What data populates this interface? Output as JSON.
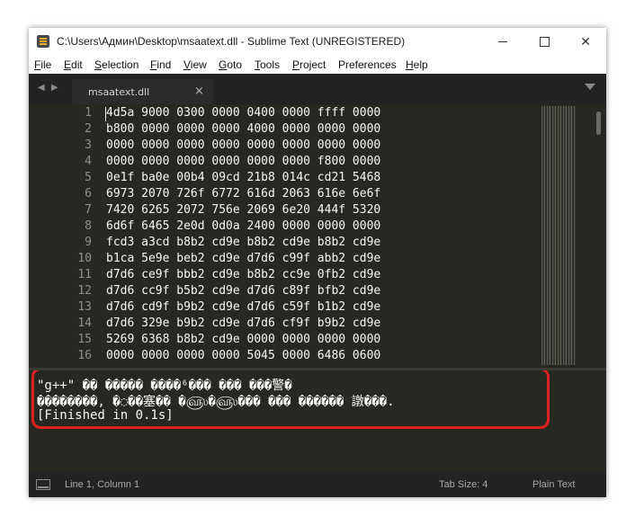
{
  "window": {
    "title": "C:\\Users\\Админ\\Desktop\\msaatext.dll - Sublime Text (UNREGISTERED)",
    "controls": {
      "minimize": "minimize",
      "maximize": "maximize",
      "close": "✕"
    }
  },
  "menu": [
    {
      "accel": "F",
      "rest": "ile"
    },
    {
      "accel": "E",
      "rest": "dit"
    },
    {
      "accel": "S",
      "rest": "election"
    },
    {
      "accel": "F",
      "rest": "ind"
    },
    {
      "accel": "V",
      "rest": "iew"
    },
    {
      "accel": "G",
      "rest": "oto"
    },
    {
      "accel": "T",
      "rest": "ools"
    },
    {
      "accel": "P",
      "rest": "roject"
    },
    {
      "accel": "",
      "rest": "Preferences"
    },
    {
      "accel": "H",
      "rest": "elp"
    }
  ],
  "tabs": {
    "nav": "◀ ▶",
    "active": {
      "label": "msaatext.dll",
      "close": "×"
    }
  },
  "editor": {
    "line_numbers": [
      "1",
      "2",
      "3",
      "4",
      "5",
      "6",
      "7",
      "8",
      "9",
      "10",
      "11",
      "12",
      "13",
      "14",
      "15",
      "16"
    ],
    "lines": [
      "4d5a 9000 0300 0000 0400 0000 ffff 0000",
      "b800 0000 0000 0000 4000 0000 0000 0000",
      "0000 0000 0000 0000 0000 0000 0000 0000",
      "0000 0000 0000 0000 0000 0000 f800 0000",
      "0e1f ba0e 00b4 09cd 21b8 014c cd21 5468",
      "6973 2070 726f 6772 616d 2063 616e 6e6f",
      "7420 6265 2072 756e 2069 6e20 444f 5320",
      "6d6f 6465 2e0d 0d0a 2400 0000 0000 0000",
      "fcd3 a3cd b8b2 cd9e b8b2 cd9e b8b2 cd9e",
      "b1ca 5e9e beb2 cd9e d7d6 c99f abb2 cd9e",
      "d7d6 ce9f bbb2 cd9e b8b2 cc9e 0fb2 cd9e",
      "d7d6 cc9f b5b2 cd9e d7d6 c89f bfb2 cd9e",
      "d7d6 cd9f b9b2 cd9e d7d6 c59f b1b2 cd9e",
      "d7d6 329e b9b2 cd9e d7d6 cf9f b9b2 cd9e",
      "5269 6368 b8b2 cd9e 0000 0000 0000 0000",
      "0000 0000 0000 0000 5045 0000 6486 0600"
    ]
  },
  "output": {
    "lines": [
      "\"g++\" �� ����� ����⁶��� ��� ���警�",
      "��������, �◌��塞�� �௵�௵��� ��� ������ 譈���.",
      "[Finished in 0.1s]"
    ]
  },
  "status": {
    "position": "Line 1, Column 1",
    "tab_size": "Tab Size: 4",
    "syntax": "Plain Text"
  },
  "colors": {
    "editor_bg": "#272822",
    "text": "#f8f8f2",
    "line_number": "#90908a",
    "highlight": "#e02020"
  }
}
